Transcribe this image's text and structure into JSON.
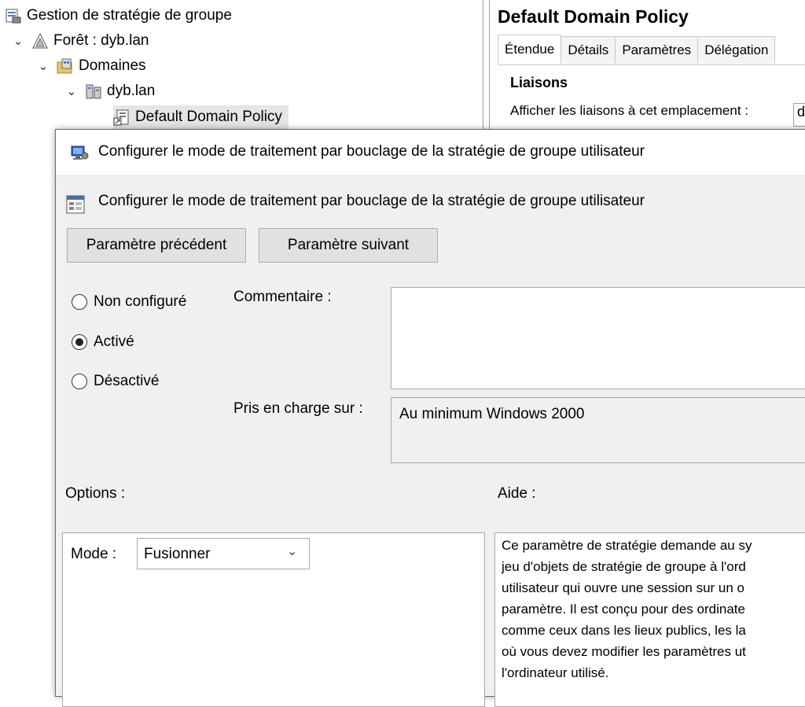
{
  "tree": {
    "root": "Gestion de stratégie de groupe",
    "forest": "Forêt : dyb.lan",
    "domains": "Domaines",
    "domain": "dyb.lan",
    "gpo": "Default Domain Policy"
  },
  "right_pane": {
    "title": "Default Domain Policy",
    "tabs": [
      "Étendue",
      "Détails",
      "Paramètres",
      "Délégation"
    ],
    "section": "Liaisons",
    "show_links_label": "Afficher les liaisons à cet emplacement :",
    "show_links_value": "d"
  },
  "dialog": {
    "title": "Configurer le mode de traitement par bouclage de la stratégie de groupe utilisateur",
    "header": "Configurer le mode de traitement par bouclage de la stratégie de groupe utilisateur",
    "prev_button": "Paramètre précédent",
    "next_button": "Paramètre suivant",
    "radios": {
      "not_configured": "Non configuré",
      "enabled": "Activé",
      "disabled": "Désactivé",
      "selected": "enabled"
    },
    "comment_label": "Commentaire :",
    "comment_value": "",
    "supported_label": "Pris en charge sur :",
    "supported_value": "Au minimum Windows 2000",
    "options_label": "Options :",
    "help_label": "Aide :",
    "mode_label": "Mode :",
    "mode_value": "Fusionner",
    "help_lines": [
      "Ce paramètre de stratégie demande au sy",
      "jeu d'objets de stratégie de groupe à l'ord",
      "utilisateur qui ouvre une session sur un o",
      "paramètre. Il est conçu pour des ordinate",
      "comme ceux dans les lieux publics, les la",
      "où vous devez modifier les paramètres ut",
      "l'ordinateur utilisé."
    ]
  }
}
